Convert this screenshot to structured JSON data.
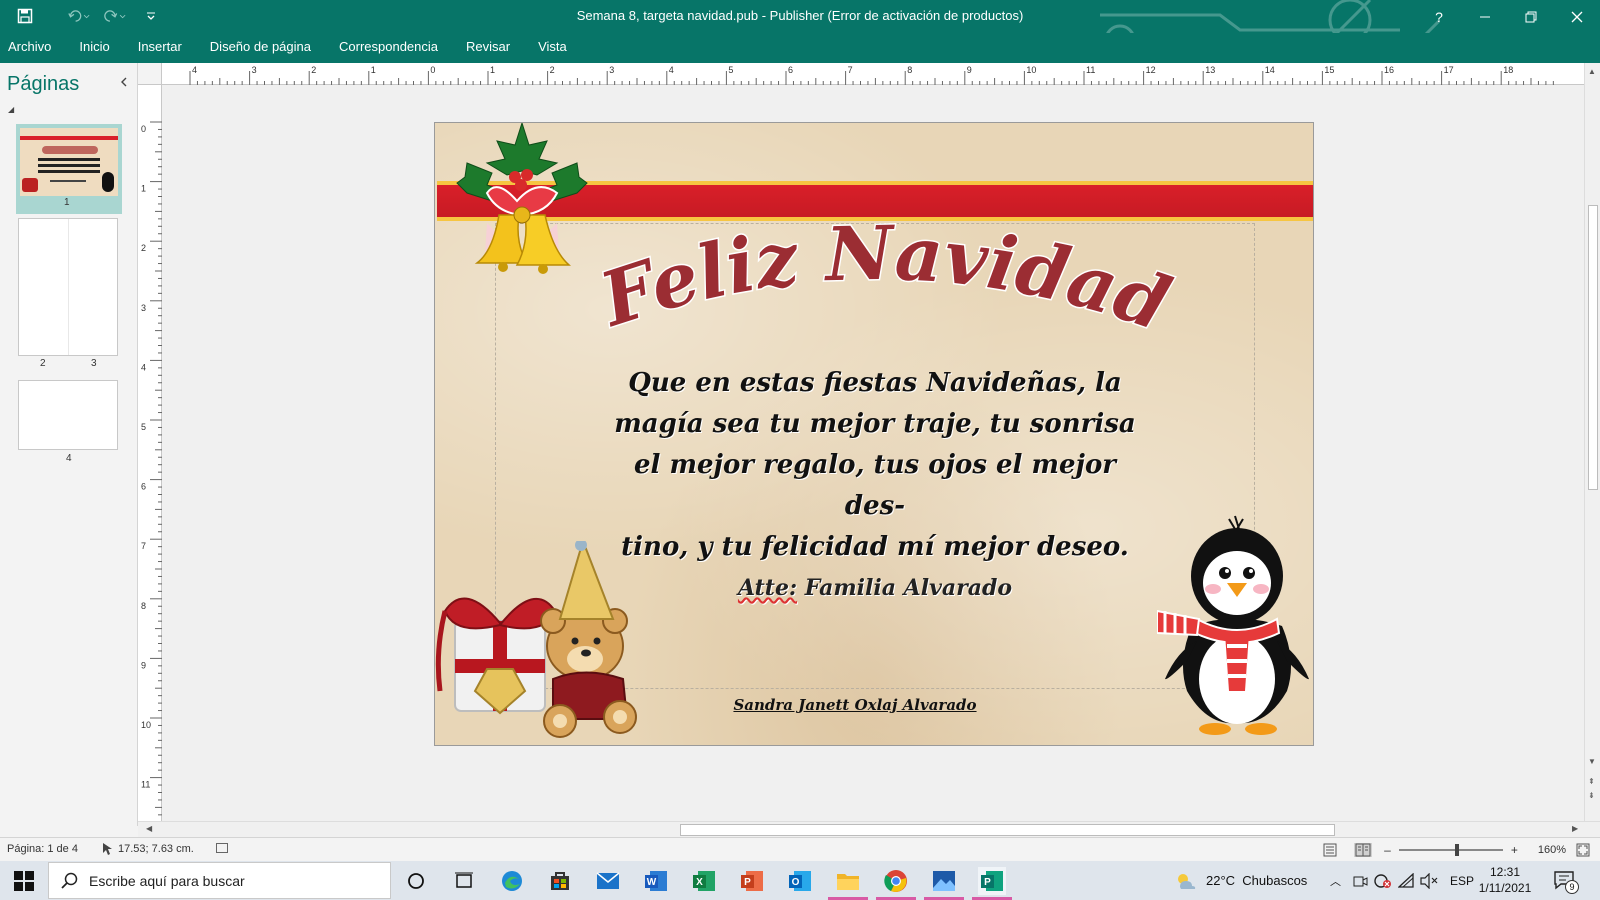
{
  "window": {
    "title": "Semana 8, targeta navidad.pub - Publisher (Error de activación de productos)",
    "help": "?",
    "accent": "#077568"
  },
  "ribbon": {
    "tabs": [
      "Archivo",
      "Inicio",
      "Insertar",
      "Diseño de página",
      "Correspondencia",
      "Revisar",
      "Vista"
    ]
  },
  "pages_pane": {
    "title": "Páginas",
    "pages": [
      "1",
      "2",
      "3",
      "4"
    ]
  },
  "rulers": {
    "horizontal": [
      "4",
      "3",
      "2",
      "1",
      "0",
      "1",
      "2",
      "3",
      "4",
      "5",
      "6",
      "7",
      "8",
      "9",
      "10",
      "11",
      "12",
      "13",
      "14",
      "15",
      "16",
      "17",
      "18"
    ],
    "vertical": [
      "0",
      "1",
      "2",
      "3",
      "4",
      "5",
      "6",
      "7",
      "8",
      "9",
      "10",
      "11"
    ]
  },
  "card": {
    "title": "Feliz Navidad",
    "body_lines": [
      "Que en estas fiestas Navideñas, la",
      "magía sea tu mejor traje, tu sonrisa",
      "el mejor regalo, tus ojos el mejor des-",
      "tino, y tu felicidad mí mejor deseo."
    ],
    "sign_prefix": "Atte:",
    "sign_name": "Familia Alvarado",
    "author": "Sandra Janett Oxlaj Alvarado"
  },
  "status": {
    "page": "Página: 1 de 4",
    "position": "17.53; 7.63 cm.",
    "zoom": "160%"
  },
  "taskbar": {
    "search_placeholder": "Escribe aquí para buscar",
    "weather": "22°C  Chubascos",
    "language": "ESP",
    "time": "12:31",
    "date": "1/11/2021",
    "notifications": "9"
  }
}
